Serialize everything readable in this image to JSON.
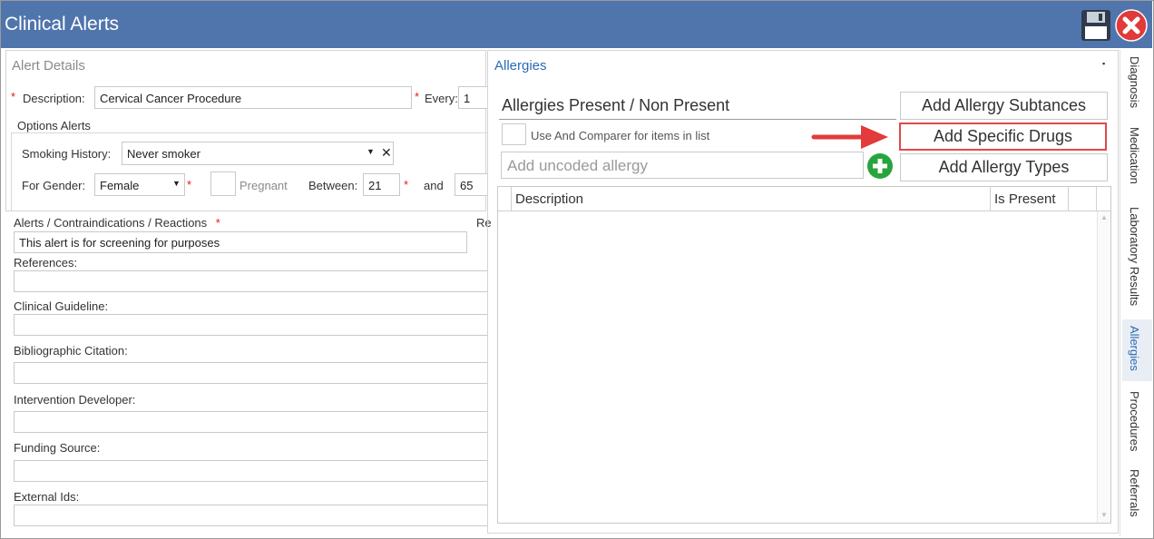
{
  "window": {
    "title": "Clinical Alerts"
  },
  "toolbar": {
    "save_icon": "floppy-disk-icon",
    "close_icon": "red-x-circle-icon"
  },
  "alert_details": {
    "section_title": "Alert Details",
    "description_label": "Description:",
    "description_value": "Cervical Cancer Procedure",
    "every_label": "Every:",
    "every_value": "1",
    "options_title": "Options Alerts",
    "smoking_label": "Smoking History:",
    "smoking_value": "Never smoker",
    "gender_label": "For Gender:",
    "gender_value": "Female",
    "pregnant_label": "Pregnant",
    "between_label": "Between:",
    "between_from": "21",
    "and_label": "and",
    "between_to": "65",
    "contra_label": "Alerts / Contraindications / Reactions",
    "contra_value": "This alert is for screening for purposes",
    "truncated_label": "Re",
    "references_label": "References:",
    "guideline_label": "Clinical Guideline:",
    "citation_label": "Bibliographic Citation:",
    "developer_label": "Intervention Developer:",
    "funding_label": "Funding Source:",
    "external_label": "External Ids:"
  },
  "allergies": {
    "section_title": "Allergies",
    "present_label": "Allergies Present / Non Present",
    "comparer_label": "Use And Comparer for items in list",
    "uncoded_placeholder": "Add uncoded allergy",
    "btn_substances": "Add Allergy Subtances",
    "btn_drugs": "Add Specific Drugs",
    "btn_types": "Add Allergy Types",
    "col_description": "Description",
    "col_is_present": "Is Present"
  },
  "side_tabs": [
    {
      "label": "Diagnosis"
    },
    {
      "label": "Medication"
    },
    {
      "label": "Laboratory Results"
    },
    {
      "label": "Allergies",
      "active": true
    },
    {
      "label": "Procedures"
    },
    {
      "label": "Referrals"
    }
  ],
  "colors": {
    "titlebar": "#5075ad",
    "accent": "#2b6bb5",
    "required": "#e41b1b",
    "highlight_arrow": "#e23b3b",
    "add_icon": "#27a53d"
  }
}
